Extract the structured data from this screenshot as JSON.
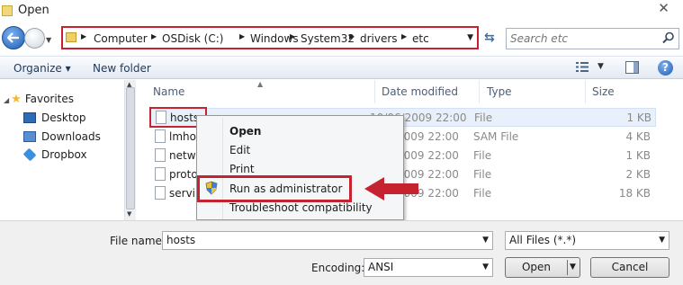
{
  "window": {
    "title": "Open",
    "close_glyph": "✕"
  },
  "address": {
    "crumbs": [
      "Computer",
      "OSDisk (C:)",
      "Windows",
      "System32",
      "drivers",
      "etc"
    ],
    "search_placeholder": "Search etc"
  },
  "toolbar": {
    "organize_label": "Organize ▾",
    "new_folder_label": "New folder",
    "help_glyph": "?"
  },
  "nav": {
    "favorites_label": "Favorites",
    "items": [
      "Desktop",
      "Downloads",
      "Dropbox"
    ]
  },
  "columns": {
    "name": "Name",
    "date": "Date modified",
    "type": "Type",
    "size": "Size"
  },
  "files": [
    {
      "name": "hosts",
      "date": "10/06/2009 22:00",
      "type": "File",
      "size": "1 KB"
    },
    {
      "name": "lmhos",
      "date": "5/06/2009 22:00",
      "type": "SAM File",
      "size": "4 KB"
    },
    {
      "name": "netwo",
      "date": "5/06/2009 22:00",
      "type": "File",
      "size": "1 KB"
    },
    {
      "name": "proto",
      "date": "5/06/2009 22:00",
      "type": "File",
      "size": "2 KB"
    },
    {
      "name": "servi",
      "date": "5/06/2009 22:00",
      "type": "File",
      "size": "18 KB"
    }
  ],
  "context_menu": {
    "items": [
      "Open",
      "Edit",
      "Print",
      "Run as administrator",
      "Troubleshoot compatibility"
    ]
  },
  "bottom": {
    "filename_label": "File name:",
    "filename_value": "hosts",
    "filter_value": "All Files  (*.*)",
    "encoding_label": "Encoding:",
    "encoding_value": "ANSI",
    "open_label": "Open",
    "cancel_label": "Cancel"
  },
  "colors": {
    "highlight": "#c62330",
    "accent": "#1e5cb3"
  }
}
